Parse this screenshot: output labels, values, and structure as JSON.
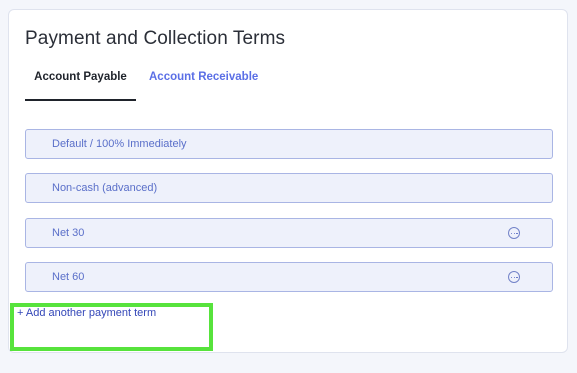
{
  "card": {
    "title": "Payment and Collection Terms"
  },
  "tabs": [
    {
      "label": "Account Payable",
      "active": true
    },
    {
      "label": "Account Receivable",
      "active": false
    }
  ],
  "payment_terms": [
    {
      "label": "Default / 100% Immediately",
      "has_menu": false
    },
    {
      "label": "Non-cash (advanced)",
      "has_menu": false
    },
    {
      "label": "Net 30",
      "has_menu": true,
      "menu_icon": "more-options-icon"
    },
    {
      "label": "Net 60",
      "has_menu": true,
      "menu_icon": "more-options-icon"
    }
  ],
  "add_term": {
    "label": "+ Add another payment term"
  },
  "colors": {
    "accent": "#5b6fe6",
    "link": "#3447b8",
    "term_bg": "#eef1fb",
    "term_border": "#a9b5e4",
    "highlight": "#57e33c"
  }
}
